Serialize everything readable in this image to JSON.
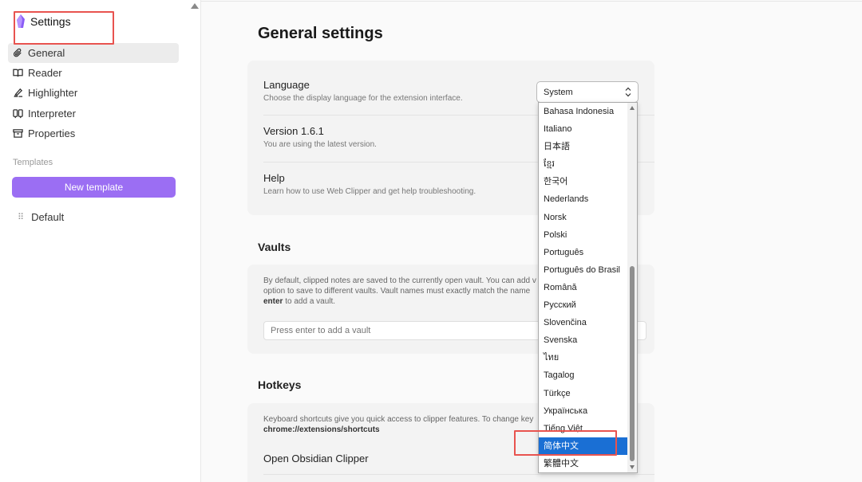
{
  "sidebar": {
    "brand": "Settings",
    "nav": [
      {
        "label": "General",
        "icon": "paperclip-icon",
        "active": true
      },
      {
        "label": "Reader",
        "icon": "book-open-icon"
      },
      {
        "label": "Highlighter",
        "icon": "highlighter-icon"
      },
      {
        "label": "Interpreter",
        "icon": "interpreter-icon"
      },
      {
        "label": "Properties",
        "icon": "archive-icon"
      }
    ],
    "templates_label": "Templates",
    "new_template_label": "New template",
    "templates": [
      {
        "label": "Default"
      }
    ]
  },
  "main": {
    "title": "General settings",
    "language": {
      "title": "Language",
      "desc": "Choose the display language for the extension interface.",
      "selected": "System",
      "options": [
        "Bahasa Indonesia",
        "Italiano",
        "日本語",
        "ខ្មែរ",
        "한국어",
        "Nederlands",
        "Norsk",
        "Polski",
        "Português",
        "Português do Brasil",
        "Română",
        "Русский",
        "Slovenčina",
        "Svenska",
        "ไทย",
        "Tagalog",
        "Türkçe",
        "Українська",
        "Tiếng Việt",
        "简体中文",
        "繁體中文"
      ],
      "highlighted_option": "简体中文"
    },
    "version": {
      "title": "Version 1.6.1",
      "desc": "You are using the latest version."
    },
    "help": {
      "title": "Help",
      "desc": "Learn how to use Web Clipper and get help troubleshooting."
    },
    "vaults": {
      "title": "Vaults",
      "desc_line1": "By default, clipped notes are saved to the currently open vault. You can add v",
      "desc_line2": "option to save to different vaults. Vault names must exactly match the name",
      "desc_bold": "enter",
      "desc_line3": " to add a vault.",
      "placeholder": "Press enter to add a vault"
    },
    "hotkeys": {
      "title": "Hotkeys",
      "desc": "Keyboard shortcuts give you quick access to clipper features. To change key",
      "link": "chrome://extensions/shortcuts",
      "item1": "Open Obsidian Clipper"
    }
  },
  "colors": {
    "accent": "#9b6ef3",
    "selection": "#1a6fd4",
    "annotation": "#e8534f"
  }
}
